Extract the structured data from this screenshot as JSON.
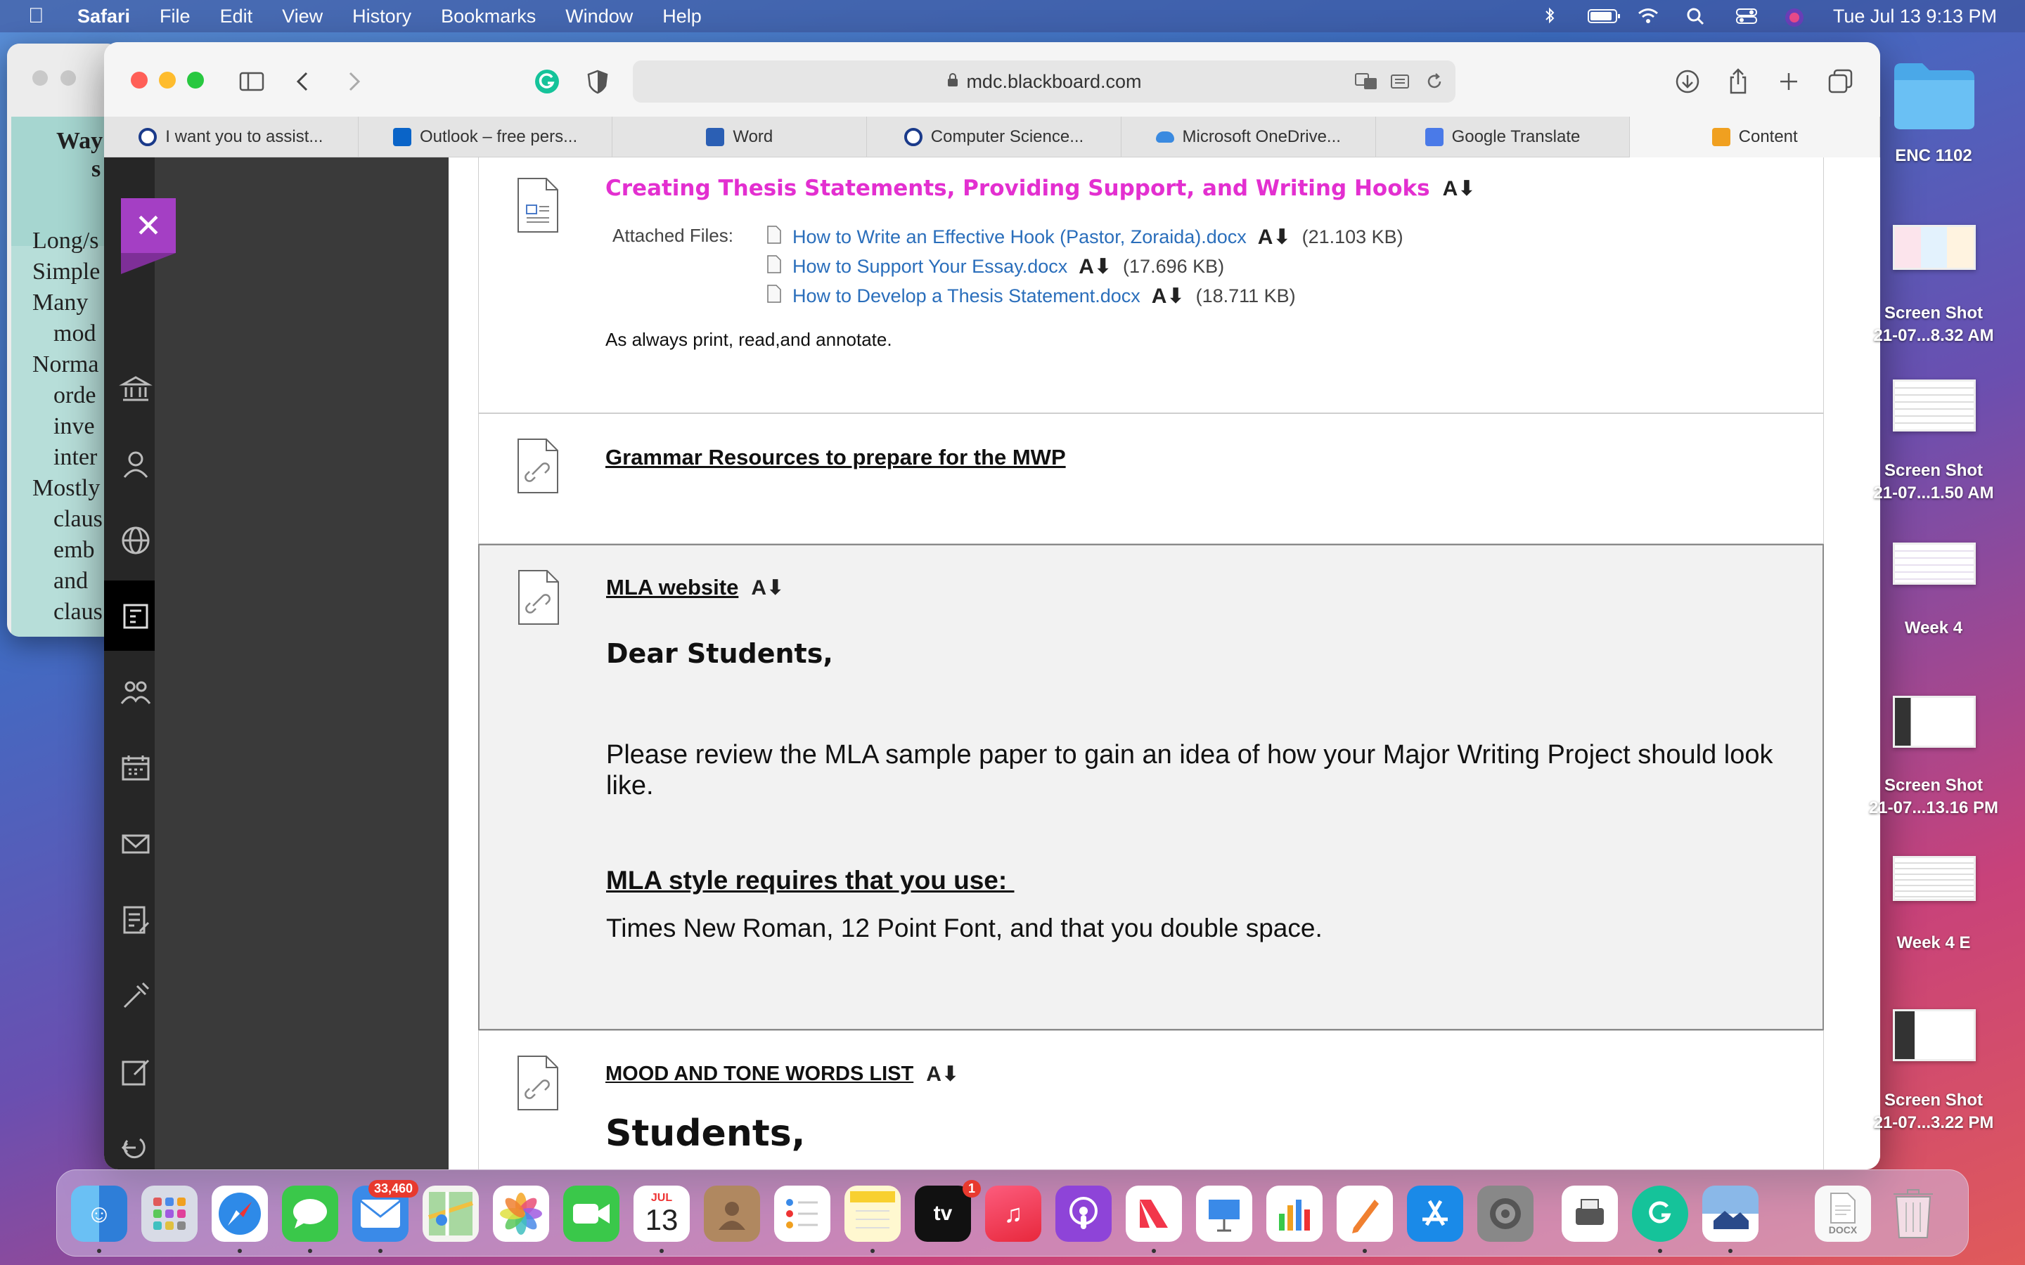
{
  "menubar": {
    "app": "Safari",
    "items": [
      "File",
      "Edit",
      "View",
      "History",
      "Bookmarks",
      "Window",
      "Help"
    ],
    "clock": "Tue Jul 13  9:13 PM"
  },
  "browser": {
    "address": "mdc.blackboard.com",
    "tabs": [
      {
        "label": "I want you to assist...",
        "icon_color": "#1a3a8a"
      },
      {
        "label": "Outlook – free pers...",
        "icon_color": "#0a64c8"
      },
      {
        "label": "Word",
        "icon_color": "#2b5fb4"
      },
      {
        "label": "Computer Science...",
        "icon_color": "#1a3a8a"
      },
      {
        "label": "Microsoft OneDrive...",
        "icon_color": "#3a8ae0"
      },
      {
        "label": "Google Translate",
        "icon_color": "#4a7ae8"
      },
      {
        "label": "Content",
        "icon_color": "#f0a020"
      }
    ]
  },
  "background_window": {
    "lines": [
      "Way",
      "s",
      "Long/s",
      "Simple",
      "Many",
      "mod",
      "Norma",
      "orde",
      "inve",
      "inter",
      "Mostly",
      "claus",
      "emb",
      "and",
      "claus"
    ]
  },
  "content": {
    "item1": {
      "title": "Creating Thesis Statements, Providing Support, and Writing Hooks",
      "attached_label": "Attached Files:",
      "files": [
        {
          "name": "How to Write an Effective Hook (Pastor, Zoraida).docx",
          "size": "(21.103 KB)"
        },
        {
          "name": "How to Support Your Essay.docx",
          "size": "(17.696 KB)"
        },
        {
          "name": "How to Develop a Thesis Statement.docx",
          "size": "(18.711 KB)"
        }
      ],
      "note": "As always print, read,and annotate."
    },
    "item2": {
      "title": "Grammar Resources to prepare for the MWP"
    },
    "item3": {
      "title": "MLA website",
      "greeting": "Dear Students,",
      "paragraph": "Please review the MLA sample paper to gain an idea of how your Major Writing Project should look like.",
      "subheading": "MLA style requires that you use: ",
      "requirements": "Times New Roman, 12 Point Font, and that you double space."
    },
    "item4": {
      "title": "MOOD AND TONE WORDS LIST",
      "greeting": "Students,"
    }
  },
  "desktop": {
    "folder": "ENC 1102",
    "items": [
      {
        "label_line1": "Screen Shot",
        "label_line2": "21-07...8.32 AM"
      },
      {
        "label_line1": "Screen Shot",
        "label_line2": "21-07...1.50 AM"
      },
      {
        "label_line1": "Week 4",
        "label_line2": ""
      },
      {
        "label_line1": "Screen Shot",
        "label_line2": "21-07...13.16 PM"
      },
      {
        "label_line1": "Week 4 E",
        "label_line2": ""
      },
      {
        "label_line1": "Screen Shot",
        "label_line2": "21-07...3.22 PM"
      }
    ]
  },
  "dock": {
    "mail_badge": "33,460",
    "calendar_month": "JUL",
    "calendar_day": "13",
    "tv_badge": "1",
    "tv_label": "tv",
    "docx_label": "DOCX"
  }
}
